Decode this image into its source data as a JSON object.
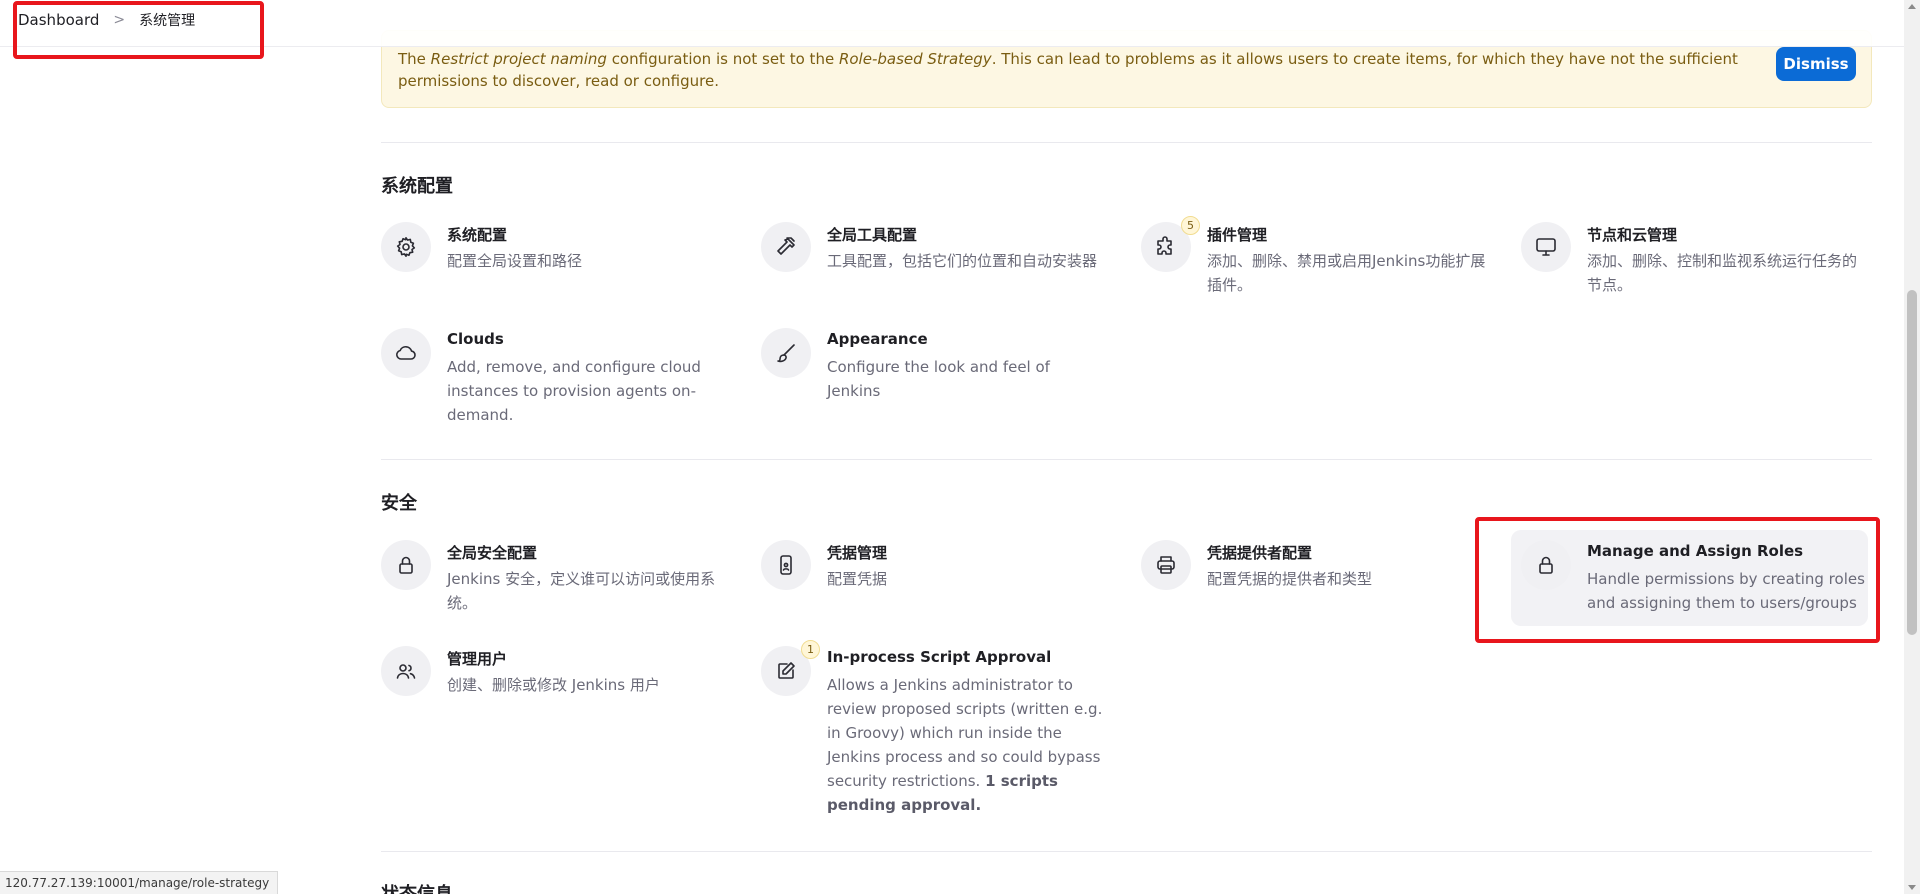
{
  "breadcrumb": {
    "root": "Dashboard",
    "current": "系统管理"
  },
  "notice": {
    "part1": "The ",
    "em1": "Restrict project naming",
    "part2": " configuration is not set to the ",
    "em2": "Role-based Strategy",
    "part3": ". This can lead to problems as it allows users to create items, for which they have not the sufficient permissions to discover, read or configure.",
    "dismiss_label": "Dismiss"
  },
  "sections": {
    "config_title": "系统配置",
    "security_title": "安全",
    "status_title": "状态信息"
  },
  "config_items": [
    {
      "title": "系统配置",
      "desc": "配置全局设置和路径"
    },
    {
      "title": "全局工具配置",
      "desc": "工具配置，包括它们的位置和自动安装器"
    },
    {
      "title": "插件管理",
      "desc": "添加、删除、禁用或启用Jenkins功能扩展插件。",
      "badge": "5"
    },
    {
      "title": "节点和云管理",
      "desc": "添加、删除、控制和监视系统运行任务的节点。"
    },
    {
      "title": "Clouds",
      "desc": "Add, remove, and configure cloud instances to provision agents on-demand."
    },
    {
      "title": "Appearance",
      "desc": "Configure the look and feel of Jenkins"
    }
  ],
  "security_items": [
    {
      "title": "全局安全配置",
      "desc": "Jenkins 安全，定义谁可以访问或使用系统。"
    },
    {
      "title": "凭据管理",
      "desc": "配置凭据"
    },
    {
      "title": "凭据提供者配置",
      "desc": "配置凭据的提供者和类型"
    },
    {
      "title": "Manage and Assign Roles",
      "desc": "Handle permissions by creating roles and assigning them to users/groups"
    },
    {
      "title": "管理用户",
      "desc": "创建、删除或修改 Jenkins 用户"
    },
    {
      "title": "In-process Script Approval",
      "desc": "Allows a Jenkins administrator to review proposed scripts (written e.g. in Groovy) which run inside the Jenkins process and so could bypass security restrictions. ",
      "desc_bold": "1 scripts pending approval.",
      "badge": "1"
    }
  ],
  "statusbar": {
    "url": "120.77.27.139:10001/manage/role-strategy"
  },
  "colors": {
    "accent": "#0b6bd6",
    "notice_bg": "#fdf7e3",
    "annotation_red": "#e8161c"
  },
  "icons": [
    "gear-icon",
    "hammer-icon",
    "puzzle-icon",
    "monitor-icon",
    "cloud-icon",
    "brush-icon",
    "lock-icon",
    "phone-id-icon",
    "printer-icon",
    "users-icon",
    "edit-icon"
  ]
}
